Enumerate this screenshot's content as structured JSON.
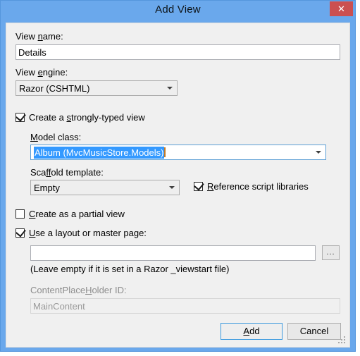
{
  "window": {
    "title": "Add View",
    "close_label": "✕",
    "close_icon": "close-icon",
    "accent_title_bar": "#6aa8ec",
    "accent_close": "#cb5050",
    "client_background": "#f0f0f0"
  },
  "form": {
    "view_name": {
      "label_pre": "View ",
      "label_acc": "n",
      "label_post": "ame:",
      "value": "Details"
    },
    "view_engine": {
      "label_pre": "View ",
      "label_acc": "e",
      "label_post": "ngine:",
      "value": "Razor (CSHTML)",
      "options": [
        "Razor (CSHTML)"
      ]
    },
    "strongly_typed": {
      "label_pre": "Create a ",
      "label_acc": "s",
      "label_post": "trongly-typed view",
      "checked": true
    },
    "model_class": {
      "label_acc": "M",
      "label_post": "odel class:",
      "value": "Album (MvcMusicStore.Models)",
      "selected": true,
      "highlight_color": "#3399ff"
    },
    "scaffold_template": {
      "label_pre": "Sca",
      "label_acc": "ff",
      "label_post": "old template:",
      "value": "Empty",
      "options": [
        "Empty"
      ]
    },
    "reference_scripts": {
      "label_acc": "R",
      "label_post": "eference script libraries",
      "checked": true
    },
    "partial_view": {
      "label_acc": "C",
      "label_post": "reate as a partial view",
      "checked": false
    },
    "use_layout": {
      "label_acc": "U",
      "label_post": "se a layout or master page:",
      "checked": true
    },
    "layout_path": {
      "value": "",
      "placeholder": ""
    },
    "browse_button": {
      "label": "..."
    },
    "layout_hint": "(Leave empty if it is set in a Razor _viewstart file)",
    "content_placeholder": {
      "label_pre": "ContentPlace",
      "label_acc": "H",
      "label_post": "older ID:",
      "value": "MainContent",
      "disabled": true
    }
  },
  "footer": {
    "add": {
      "label_acc": "A",
      "label_post": "dd"
    },
    "cancel": {
      "label": "Cancel"
    },
    "grip_icon": "resize-grip-icon"
  }
}
